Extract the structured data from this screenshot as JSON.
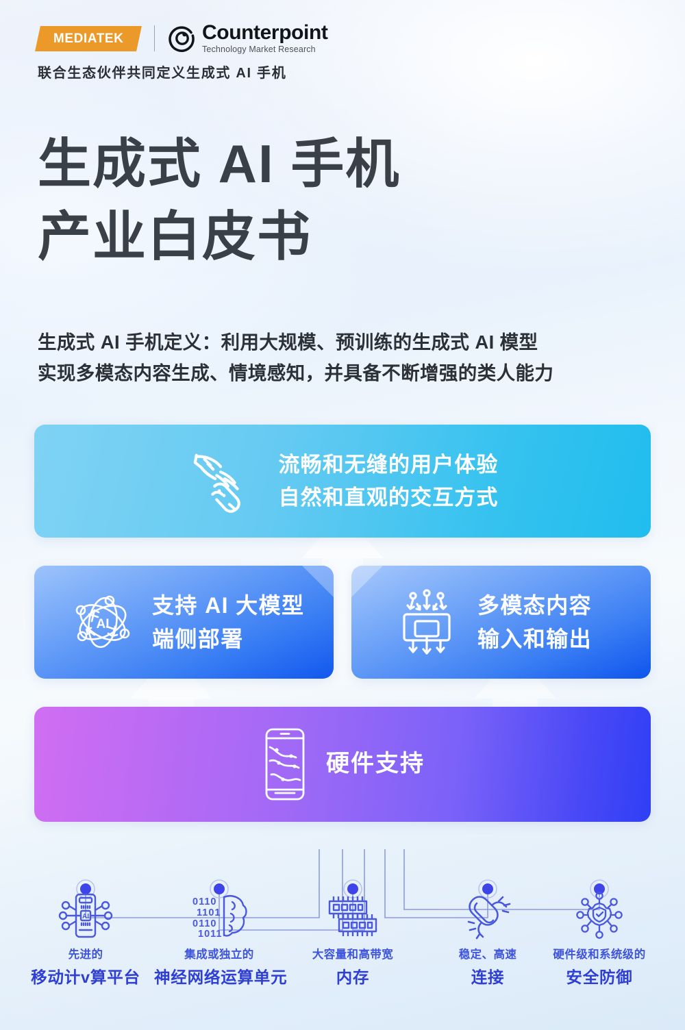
{
  "header": {
    "mediatek_logo_text": "MEDIATEK",
    "counterpoint_name": "Counterpoint",
    "counterpoint_sub": "Technology Market Research",
    "counterpoint_icon": "counterpoint-circle-logo",
    "tagline": "联合生态伙伴共同定义生成式 AI 手机"
  },
  "title": {
    "line1": "生成式 AI 手机",
    "line2": "产业白皮书"
  },
  "definition": {
    "line1": "生成式 AI 手机定义：利用大规模、预训练的生成式 AI 模型",
    "line2": "实现多模态内容生成、情境感知，并具备不断增强的类人能力"
  },
  "pyramid": {
    "layers": [
      {
        "id": "user-experience",
        "icon": "hand-touch-gesture-icon",
        "text_lines": [
          "流畅和无缝的用户体验",
          "自然和直观的交互方式"
        ],
        "color_start": "#7fd3f4",
        "color_end": "#20bdee"
      },
      {
        "id": "ai-model-on-device",
        "icon": "ai-atom-network-icon",
        "text_lines": [
          "支持 AI 大模型",
          "端侧部署"
        ],
        "color_start": "#9dc3fb",
        "color_end": "#1158ee"
      },
      {
        "id": "multimodal-io",
        "icon": "multimodal-chip-io-icon",
        "text_lines": [
          "多模态内容",
          "输入和输出"
        ],
        "color_start": "#a7c8fc",
        "color_end": "#0d55ed"
      },
      {
        "id": "hardware-support",
        "icon": "phone-circuit-icon",
        "text_lines": [
          "硬件支持"
        ],
        "color_start": "#d06ef2",
        "color_end": "#2f3ff5"
      }
    ]
  },
  "hardware_items": [
    {
      "id": "mobile-compute-platform",
      "icon": "phone-ai-chip-nodes-icon",
      "qualifier": "先进的",
      "label": "移动计v算平台"
    },
    {
      "id": "neural-processing-unit",
      "icon": "binary-brain-icon",
      "qualifier": "集成或独立的",
      "label": "神经网络运算单元"
    },
    {
      "id": "memory",
      "icon": "memory-chips-icon",
      "qualifier": "大容量和高带宽",
      "label": "内存"
    },
    {
      "id": "connectivity",
      "icon": "chain-link-icon",
      "qualifier": "稳定、高速",
      "label": "连接"
    },
    {
      "id": "security",
      "icon": "shield-gear-nodes-icon",
      "qualifier": "硬件级和系统级的",
      "label": "安全防御"
    }
  ],
  "colors": {
    "brand_orange": "#eb9a2a",
    "accent_blue": "#2f3fd4",
    "cyan": "#35c2ef",
    "blue": "#1158ee",
    "purple": "#a069f6",
    "indigo": "#2f3ff5",
    "title_gray": "#3a4047"
  }
}
